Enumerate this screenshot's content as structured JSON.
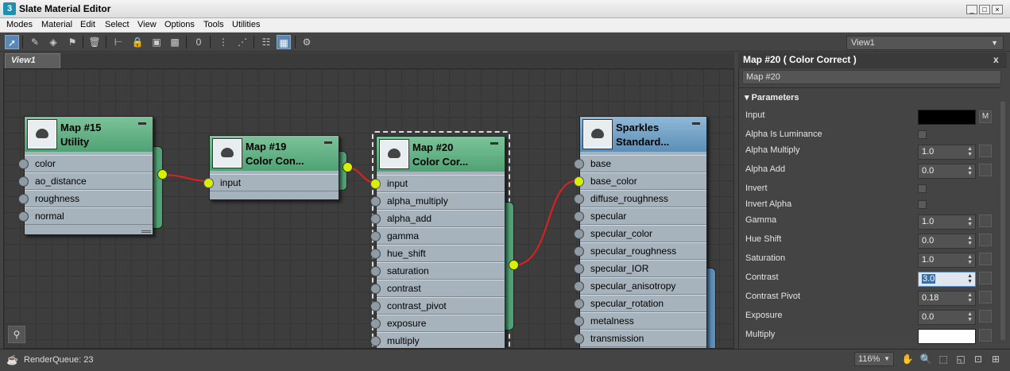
{
  "window": {
    "title": "Slate Material Editor",
    "app_icon": "3",
    "min": "_",
    "max": "□",
    "close": "×"
  },
  "menu": [
    "Modes",
    "Material",
    "Edit",
    "Select",
    "View",
    "Options",
    "Tools",
    "Utilities"
  ],
  "toolbar": {
    "icons": [
      "select-arrow-icon",
      "eyedropper-icon",
      "put-to-scene-icon",
      "assign-icon",
      "delete-icon",
      "move-children-icon",
      "lock-icon",
      "bg-icon",
      "checker-icon",
      "show-map-icon",
      "layout-icon",
      "layout-children-icon",
      "hide-icon",
      "pan-icon",
      "options-icon",
      "rollout-icon"
    ],
    "view_select": "View1"
  },
  "view_tab": "View1",
  "nodes": {
    "n15": {
      "title1": "Map #15",
      "title2": "Utility",
      "slots": [
        "color",
        "ao_distance",
        "roughness",
        "normal"
      ]
    },
    "n19": {
      "title1": "Map #19",
      "title2": "Color Con...",
      "slots": [
        "input"
      ]
    },
    "n20": {
      "title1": "Map #20",
      "title2": "Color Cor...",
      "slots": [
        "input",
        "alpha_multiply",
        "alpha_add",
        "gamma",
        "hue_shift",
        "saturation",
        "contrast",
        "contrast_pivot",
        "exposure",
        "multiply"
      ]
    },
    "sparkles": {
      "title1": "Sparkles",
      "title2": "Standard...",
      "slots": [
        "base",
        "base_color",
        "diffuse_roughness",
        "specular",
        "specular_color",
        "specular_roughness",
        "specular_IOR",
        "specular_anisotropy",
        "specular_rotation",
        "metalness",
        "transmission"
      ]
    }
  },
  "panel": {
    "title": "Map #20  ( Color Correct )",
    "close": "x",
    "name": "Map #20",
    "section": "Parameters",
    "params": [
      {
        "label": "Input",
        "type": "swatch",
        "color": "#000000",
        "btn": "M"
      },
      {
        "label": "Alpha Is Luminance",
        "type": "check"
      },
      {
        "label": "Alpha Multiply",
        "type": "spin",
        "value": "1.0"
      },
      {
        "label": "Alpha Add",
        "type": "spin",
        "value": "0.0"
      },
      {
        "label": "Invert",
        "type": "check"
      },
      {
        "label": "Invert Alpha",
        "type": "check"
      },
      {
        "label": "Gamma",
        "type": "spin",
        "value": "1.0"
      },
      {
        "label": "Hue Shift",
        "type": "spin",
        "value": "0.0"
      },
      {
        "label": "Saturation",
        "type": "spin",
        "value": "1.0"
      },
      {
        "label": "Contrast",
        "type": "spin",
        "value": "3.0",
        "selected": true
      },
      {
        "label": "Contrast Pivot",
        "type": "spin",
        "value": "0.18"
      },
      {
        "label": "Exposure",
        "type": "spin",
        "value": "0.0"
      },
      {
        "label": "Multiply",
        "type": "swatch",
        "color": "#ffffff"
      }
    ]
  },
  "status": {
    "render_queue": "RenderQueue: 23",
    "zoom": "116%"
  },
  "colors": {
    "node_header": "#5fae82",
    "node_header_blue": "#6f9dc4",
    "port_active": "#d8f000",
    "wire": "#e02020"
  }
}
